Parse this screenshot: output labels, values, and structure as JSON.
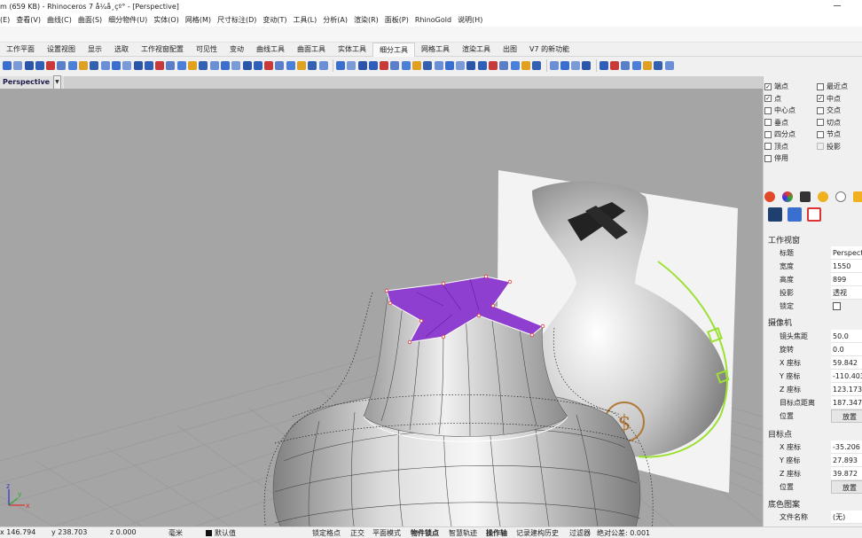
{
  "window": {
    "title": "m (659 KB) - Rhinoceros 7 å¼å¸çº° - [Perspective]"
  },
  "menu": [
    "(E)",
    "查看(V)",
    "曲线(C)",
    "曲面(S)",
    "细分物件(U)",
    "实体(O)",
    "网格(M)",
    "尺寸标注(D)",
    "变动(T)",
    "工具(L)",
    "分析(A)",
    "渲染(R)",
    "面板(P)",
    "RhinoGold",
    "说明(H)"
  ],
  "tabs": [
    "工作平面",
    "设置视图",
    "显示",
    "选取",
    "工作视窗配置",
    "可见性",
    "变动",
    "曲线工具",
    "曲面工具",
    "实体工具",
    "细分工具",
    "网格工具",
    "渲染工具",
    "出图",
    "V7 的新功能"
  ],
  "active_tab": "细分工具",
  "viewport": {
    "name": "Perspective"
  },
  "model": {
    "coin_symbol": "$"
  },
  "osnap": [
    {
      "label": "端点",
      "checked": true
    },
    {
      "label": "最近点",
      "checked": false
    },
    {
      "label": "点",
      "checked": true
    },
    {
      "label": "中点",
      "checked": true
    },
    {
      "label": "中心点",
      "checked": false
    },
    {
      "label": "交点",
      "checked": false
    },
    {
      "label": "垂点",
      "checked": false
    },
    {
      "label": "切点",
      "checked": false
    },
    {
      "label": "四分点",
      "checked": false
    },
    {
      "label": "节点",
      "checked": false
    },
    {
      "label": "顶点",
      "checked": false
    },
    {
      "label": "投影",
      "checked": false
    },
    {
      "label": "停用",
      "checked": false
    }
  ],
  "panel": {
    "section_viewport": "工作视窗",
    "viewport_props": [
      {
        "key": "标题",
        "value": "Perspective"
      },
      {
        "key": "宽度",
        "value": "1550"
      },
      {
        "key": "高度",
        "value": "899"
      },
      {
        "key": "投影",
        "value": "透视"
      },
      {
        "key": "锁定",
        "value": ""
      }
    ],
    "section_camera": "摄像机",
    "camera_props": [
      {
        "key": "镜头焦距",
        "value": "50.0"
      },
      {
        "key": "旋转",
        "value": "0.0"
      },
      {
        "key": "X 座标",
        "value": "59.842"
      },
      {
        "key": "Y 座标",
        "value": "-110.403"
      },
      {
        "key": "Z 座标",
        "value": "123.173"
      },
      {
        "key": "目标点距离",
        "value": "187.347"
      },
      {
        "key": "位置",
        "value": "放置"
      }
    ],
    "section_target": "目标点",
    "target_props": [
      {
        "key": "X 座标",
        "value": "-35.206"
      },
      {
        "key": "Y 座标",
        "value": "27.893"
      },
      {
        "key": "Z 座标",
        "value": "39.872"
      },
      {
        "key": "位置",
        "value": "放置"
      }
    ],
    "section_wallpaper": "底色图案",
    "wallpaper_props": [
      {
        "key": "文件名称",
        "value": "(无)"
      }
    ]
  },
  "status": {
    "x": "x 146.794",
    "y": "y 238.703",
    "z": "z 0.000",
    "unit": "毫米",
    "layer": "默认值",
    "items": [
      "锁定格点",
      "正交",
      "平面模式",
      "物件锁点",
      "智慧轨迹",
      "操作轴",
      "记录建构历史",
      "过滤器",
      "绝对公差: 0.001"
    ],
    "bold_items": [
      "物件锁点",
      "操作轴"
    ]
  },
  "axes": {
    "x": "x",
    "y": "y",
    "z": "z"
  },
  "colors": {
    "viewport_bg": "#a5a5a5",
    "selection": "#8e3fd0",
    "highlight": "#9be033"
  }
}
